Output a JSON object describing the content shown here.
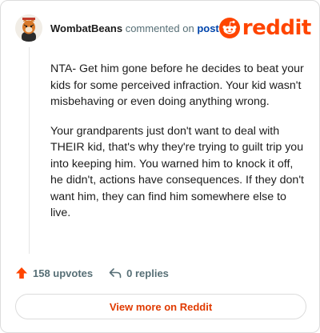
{
  "header": {
    "author": "WombatBeans",
    "commented_on": "commented on",
    "post_link": "post",
    "logo_text": "reddit"
  },
  "comment": {
    "paragraphs": [
      "NTA- Get him gone before he decides to beat your kids for some perceived infraction. Your kid wasn't misbehaving or even doing anything wrong.",
      "Your grandparents just don't want to deal with THEIR kid, that's why they're trying to guilt trip you into keeping him. You warned him to knock it off, he didn't, actions have consequences. If they don't want him, they can find him somewhere else to live."
    ]
  },
  "actions": {
    "upvotes": "158 upvotes",
    "replies": "0 replies"
  },
  "footer": {
    "view_more": "View more on Reddit"
  },
  "colors": {
    "brand": "#ff4500",
    "link": "#0045ac",
    "muted": "#576f76"
  }
}
